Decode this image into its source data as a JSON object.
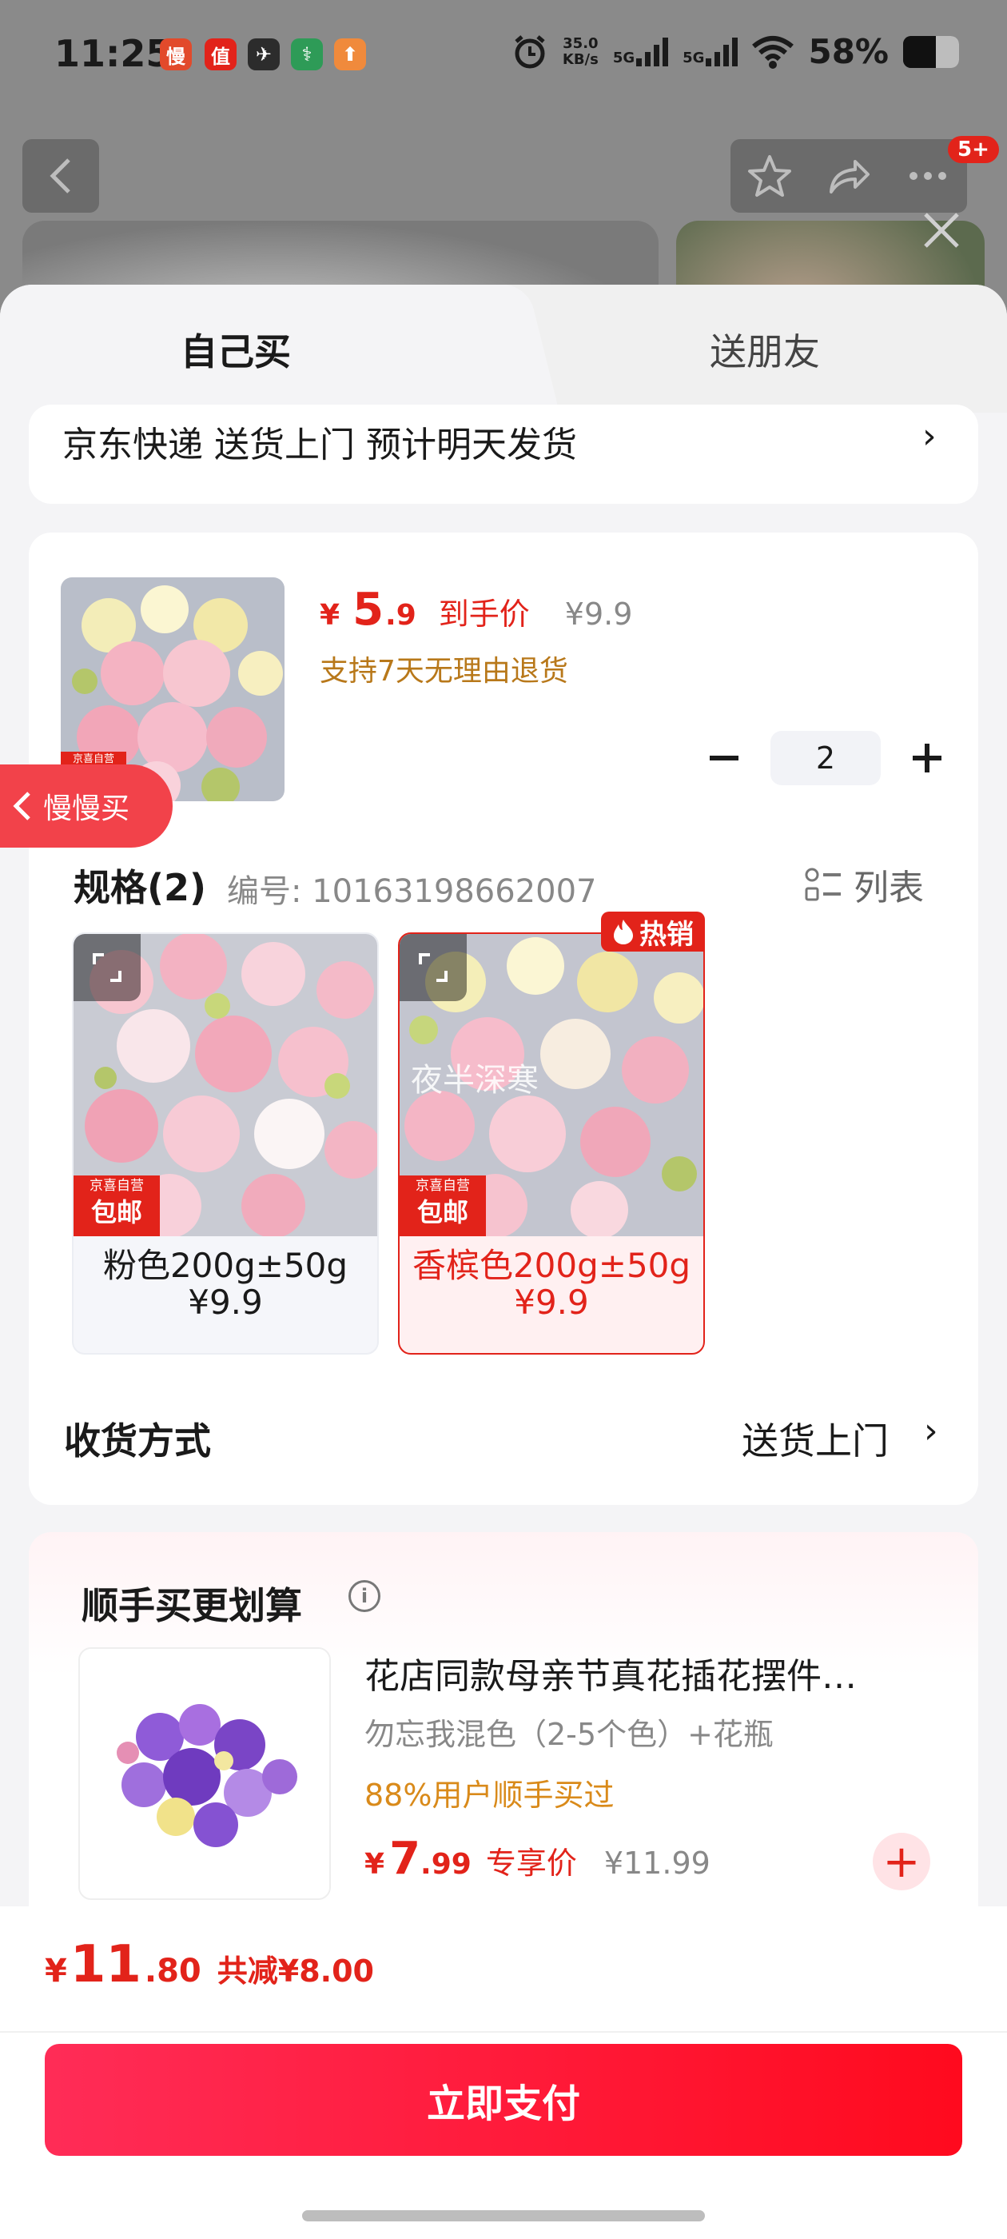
{
  "status_bar": {
    "time": "11:25",
    "apps": [
      {
        "name": "慢",
        "color": "#e24a2b"
      },
      {
        "name": "值",
        "color": "#e2231a"
      },
      {
        "name": "✈",
        "color": "#2c2c2c"
      },
      {
        "name": "⚕",
        "color": "#2e9b57"
      },
      {
        "name": "⬆",
        "color": "#f08a3c"
      }
    ],
    "net_speed_value": "35.0",
    "net_speed_unit": "KB/s",
    "sig1": "5G",
    "sig2": "5G",
    "battery_text": "58%",
    "battery_level": 0.58
  },
  "header": {
    "notification_badge": "5+"
  },
  "tabs": {
    "self_buy": "自己买",
    "gift_friend": "送朋友"
  },
  "delivery": {
    "text": "京东快递 送货上门 预计明天发货"
  },
  "product": {
    "price_symbol": "¥",
    "price_int": "5",
    "price_dec": ".9",
    "price_tag": "到手价",
    "original_price": "¥9.9",
    "return_policy": "支持7天无理由退货",
    "quantity": "2",
    "thumb_badge_small": "京喜自营",
    "thumb_badge_big": "包邮"
  },
  "spec": {
    "title": "规格(2)",
    "code": "编号: 10163198662007",
    "list_label": "列表",
    "variants": [
      {
        "name": "粉色200g±50g",
        "price": "¥9.9",
        "badge_small": "京喜自营",
        "badge_big": "包邮"
      },
      {
        "name": "香槟色200g±50g",
        "price": "¥9.9",
        "badge_small": "京喜自营",
        "badge_big": "包邮",
        "hot": "热销",
        "watermark": "夜半深寒"
      }
    ]
  },
  "receive": {
    "label": "收货方式",
    "value": "送货上门"
  },
  "addon": {
    "title": "顺手买更划算",
    "name": "花店同款母亲节真花插花摆件…",
    "spec": "勿忘我混色（2-5个色）+花瓶",
    "social": "88%用户顺手买过",
    "price_symbol": "¥",
    "price_int": "7",
    "price_dec": ".99",
    "price_tag": "专享价",
    "original_price": "¥11.99"
  },
  "side_tab": {
    "label": "慢慢买"
  },
  "bottom": {
    "total_symbol": "¥",
    "total_int": "11",
    "total_dec": ".80",
    "discount": "共减¥8.00",
    "pay_label": "立即支付"
  }
}
